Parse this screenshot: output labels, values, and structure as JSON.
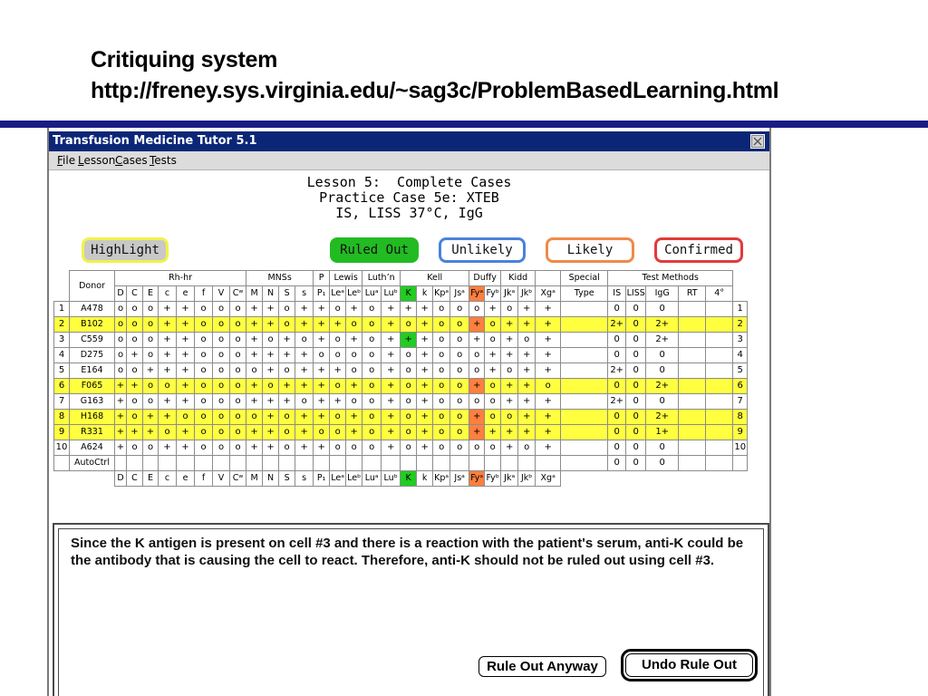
{
  "slide": {
    "title_line1": "Critiquing system",
    "title_line2": "http://freney.sys.virginia.edu/~sag3c/ProblemBasedLearning.html"
  },
  "window": {
    "title": "Transfusion Medicine Tutor 5.1",
    "titlebar_color": "#0c2677",
    "close_icon": "close-icon"
  },
  "menu": [
    "File",
    "Lesson",
    "Cases",
    "Tests"
  ],
  "lesson": {
    "line1": "Lesson 5:  Complete Cases",
    "line2": "Practice Case 5e: XTEB",
    "line3": "IS, LISS 37°C, IgG"
  },
  "legend": [
    {
      "label": "HighLight",
      "fill": "#c8c8c8",
      "border": "#f2f24a"
    },
    {
      "label": "Ruled Out",
      "fill": "#22bb22",
      "border": "#22bb22"
    },
    {
      "label": "Unlikely",
      "fill": "#ffffff",
      "border": "#4a82dc"
    },
    {
      "label": "Likely",
      "fill": "#ffffff",
      "border": "#f08a4a"
    },
    {
      "label": "Confirmed",
      "fill": "#ffffff",
      "border": "#e23a3a"
    }
  ],
  "antigram": {
    "donor_header": "Donor",
    "groups": [
      {
        "label": "Rh-hr",
        "span": 8
      },
      {
        "label": "MNSs",
        "span": 4
      },
      {
        "label": "P",
        "span": 1
      },
      {
        "label": "Lewis",
        "span": 2
      },
      {
        "label": "Luth’n",
        "span": 2
      },
      {
        "label": "Kell",
        "span": 4
      },
      {
        "label": "Duffy",
        "span": 2
      },
      {
        "label": "Kidd",
        "span": 2
      },
      {
        "label": "",
        "span": 1
      }
    ],
    "special_header_top": "Special",
    "special_header_bottom": "Type",
    "tests_header": "Test Methods",
    "antigens": [
      "D",
      "C",
      "E",
      "c",
      "e",
      "f",
      "V",
      "Cʷ",
      "M",
      "N",
      "S",
      "s",
      "P₁",
      "Leᵃ",
      "Leᵇ",
      "Luᵃ",
      "Luᵇ",
      "K",
      "k",
      "Kpᵃ",
      "Jsᵃ",
      "Fyᵃ",
      "Fyᵇ",
      "Jkᵃ",
      "Jkᵇ",
      "Xgᵃ"
    ],
    "tests": [
      "IS",
      "LISS",
      "IgG",
      "RT",
      "4°"
    ],
    "header_fills": {
      "17": "#22cc22",
      "21": "#ff7f3f"
    },
    "highlight_color": "#ffff40",
    "rows": [
      {
        "num": "1",
        "donor": "A478",
        "highlight": false,
        "fills": {},
        "cells": [
          "o",
          "o",
          "o",
          "+",
          "+",
          "o",
          "o",
          "o",
          "+",
          "+",
          "o",
          "+",
          "+",
          "o",
          "+",
          "o",
          "+",
          "+",
          "+",
          "o",
          "o",
          "o",
          "+",
          "o",
          "+",
          "+"
        ],
        "results": [
          "0",
          "0",
          "0",
          "",
          ""
        ]
      },
      {
        "num": "2",
        "donor": "B102",
        "highlight": true,
        "fills": {
          "21": "#ff7f3f"
        },
        "cells": [
          "o",
          "o",
          "o",
          "+",
          "+",
          "o",
          "o",
          "o",
          "+",
          "+",
          "o",
          "+",
          "+",
          "+",
          "o",
          "o",
          "+",
          "o",
          "+",
          "o",
          "o",
          "+",
          "o",
          "+",
          "+",
          "+"
        ],
        "results": [
          "2+",
          "0",
          "2+",
          "",
          ""
        ]
      },
      {
        "num": "3",
        "donor": "C559",
        "highlight": false,
        "fills": {
          "17": "#22cc22"
        },
        "cells": [
          "o",
          "o",
          "o",
          "+",
          "+",
          "o",
          "o",
          "o",
          "+",
          "o",
          "+",
          "o",
          "+",
          "o",
          "+",
          "o",
          "+",
          "+",
          "+",
          "o",
          "o",
          "+",
          "o",
          "+",
          "o",
          "+"
        ],
        "results": [
          "0",
          "0",
          "2+",
          "",
          ""
        ]
      },
      {
        "num": "4",
        "donor": "D275",
        "highlight": false,
        "fills": {},
        "cells": [
          "o",
          "+",
          "o",
          "+",
          "+",
          "o",
          "o",
          "o",
          "+",
          "+",
          "+",
          "+",
          "o",
          "o",
          "o",
          "o",
          "+",
          "o",
          "+",
          "o",
          "o",
          "o",
          "+",
          "+",
          "+",
          "+"
        ],
        "results": [
          "0",
          "0",
          "0",
          "",
          ""
        ]
      },
      {
        "num": "5",
        "donor": "E164",
        "highlight": false,
        "fills": {},
        "cells": [
          "o",
          "o",
          "+",
          "+",
          "+",
          "o",
          "o",
          "o",
          "o",
          "+",
          "o",
          "+",
          "+",
          "+",
          "o",
          "o",
          "+",
          "o",
          "+",
          "o",
          "o",
          "o",
          "+",
          "o",
          "+",
          "+"
        ],
        "results": [
          "2+",
          "0",
          "0",
          "",
          ""
        ]
      },
      {
        "num": "6",
        "donor": "F065",
        "highlight": true,
        "fills": {
          "21": "#ff7f3f"
        },
        "cells": [
          "+",
          "+",
          "o",
          "o",
          "+",
          "o",
          "o",
          "o",
          "+",
          "o",
          "+",
          "+",
          "+",
          "o",
          "+",
          "o",
          "+",
          "o",
          "+",
          "o",
          "o",
          "+",
          "o",
          "+",
          "+",
          "o"
        ],
        "results": [
          "0",
          "0",
          "2+",
          "",
          ""
        ]
      },
      {
        "num": "7",
        "donor": "G163",
        "highlight": false,
        "fills": {},
        "cells": [
          "+",
          "o",
          "o",
          "+",
          "+",
          "o",
          "o",
          "o",
          "+",
          "+",
          "+",
          "o",
          "+",
          "+",
          "o",
          "o",
          "+",
          "o",
          "+",
          "o",
          "o",
          "o",
          "o",
          "+",
          "+",
          "+"
        ],
        "results": [
          "2+",
          "0",
          "0",
          "",
          ""
        ]
      },
      {
        "num": "8",
        "donor": "H168",
        "highlight": true,
        "fills": {
          "21": "#ff7f3f"
        },
        "cells": [
          "+",
          "o",
          "+",
          "+",
          "o",
          "o",
          "o",
          "o",
          "o",
          "+",
          "o",
          "+",
          "+",
          "o",
          "+",
          "o",
          "+",
          "o",
          "+",
          "o",
          "o",
          "+",
          "o",
          "o",
          "+",
          "+"
        ],
        "results": [
          "0",
          "0",
          "2+",
          "",
          ""
        ]
      },
      {
        "num": "9",
        "donor": "R331",
        "highlight": true,
        "fills": {
          "21": "#ff7f3f"
        },
        "cells": [
          "+",
          "+",
          "+",
          "o",
          "+",
          "o",
          "o",
          "o",
          "+",
          "+",
          "o",
          "+",
          "o",
          "o",
          "+",
          "o",
          "+",
          "o",
          "+",
          "o",
          "o",
          "+",
          "+",
          "+",
          "+",
          "+"
        ],
        "results": [
          "0",
          "0",
          "1+",
          "",
          ""
        ]
      },
      {
        "num": "10",
        "donor": "A624",
        "highlight": false,
        "fills": {},
        "cells": [
          "+",
          "o",
          "o",
          "+",
          "+",
          "o",
          "o",
          "o",
          "+",
          "+",
          "o",
          "+",
          "+",
          "o",
          "o",
          "o",
          "+",
          "o",
          "+",
          "o",
          "o",
          "o",
          "o",
          "+",
          "o",
          "+"
        ],
        "results": [
          "0",
          "0",
          "0",
          "",
          ""
        ]
      }
    ],
    "auto_control": {
      "donor": "AutoCtrl",
      "results": [
        "0",
        "0",
        "0",
        "",
        ""
      ]
    }
  },
  "message": {
    "text": "Since the K antigen is present on cell #3 and there is a reaction with the patient's serum, anti-K could be the antibody that is causing the cell to react.  Therefore, anti-K should not be ruled out using cell #3.",
    "rule_out_anyway": "Rule Out Anyway",
    "undo_rule_out": "Undo Rule Out"
  }
}
